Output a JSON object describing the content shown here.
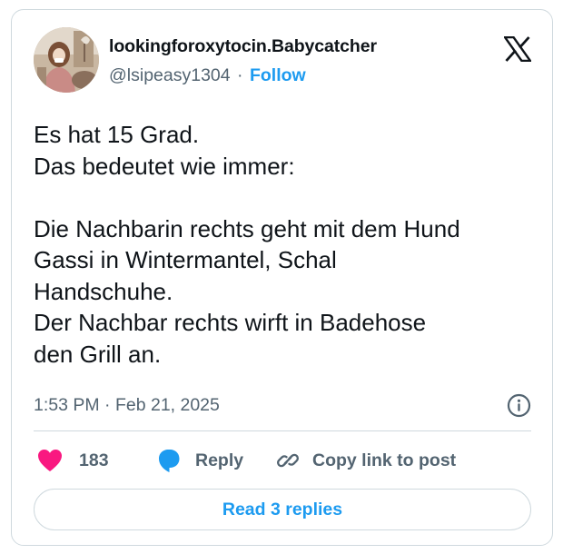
{
  "author": {
    "display_name": "lookingforoxytocin.Babycatcher",
    "handle": "@lsipeasy1304",
    "separator": "·",
    "follow_label": "Follow",
    "avatar_icon": "avatar-photo"
  },
  "tweet": {
    "lines": [
      "Es hat 15 Grad.",
      "Das bedeutet wie immer:",
      "",
      "Die Nachbarin rechts geht mit dem Hund",
      "Gassi in Wintermantel, Schal",
      "Handschuhe.",
      "Der Nachbar rechts wirft in Badehose",
      "den Grill an."
    ],
    "timestamp": "1:53 PM · Feb 21, 2025"
  },
  "actions": {
    "like_count": "183",
    "reply_label": "Reply",
    "copy_link_label": "Copy link to post"
  },
  "read_replies_label": "Read 3 replies",
  "colors": {
    "accent": "#1d9bf0",
    "like": "#f91880",
    "text": "#0f1419",
    "muted": "#536471",
    "border": "#cfd9de"
  }
}
